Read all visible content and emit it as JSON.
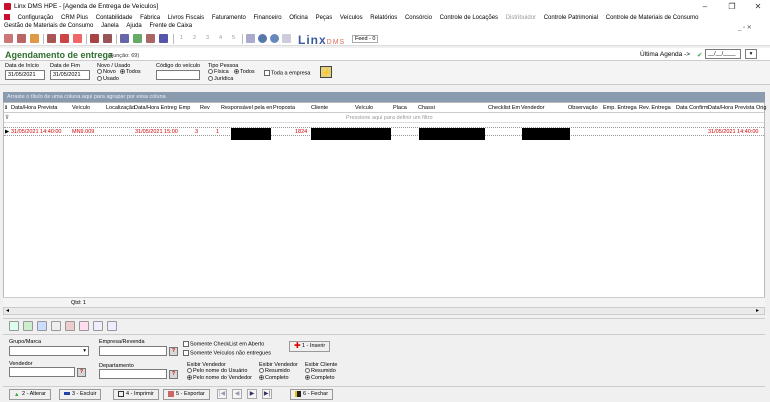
{
  "window": {
    "title": "Linx DMS HPE - [Agenda de Entrega de Veículos]",
    "minimize": "–",
    "restore": "❐",
    "close": "✕",
    "mdi_controls": "_ ▫ ✕"
  },
  "menu": {
    "row1": [
      "Configuração",
      "CRM Plus",
      "Contabilidade",
      "Fábrica",
      "Livros Fiscais",
      "Faturamento",
      "Financeiro",
      "Oficina",
      "Peças",
      "Veículos",
      "Relatórios",
      "Consórcio",
      "Controle de Locações",
      "Distribuidor",
      "Controle Patrimonial",
      "Controle de Materiais de Consumo"
    ],
    "row2": [
      "Gestão de Materiais de Consumo",
      "Janela",
      "Ajuda",
      "Frente de Caixa"
    ]
  },
  "toolbar": {
    "numbers": [
      "1",
      "2",
      "3",
      "4",
      "5"
    ],
    "brand": "Linx",
    "brand_suffix": "DMS",
    "feed": "Feed - 0"
  },
  "header": {
    "title": "Agendamento de entrega",
    "function": "(Função: 69)",
    "ultima_agenda": "Última Agenda ->",
    "ultima_agenda_value": "__/__/____"
  },
  "filters": {
    "data_inicio_label": "Data de Início",
    "data_inicio": "31/05/2021",
    "data_fim_label": "Data de Fim",
    "data_fim": "31/05/2021",
    "novo_usado_label": "Novo / Usado",
    "novo": "Novo",
    "todos": "Todos",
    "usado": "Usado",
    "codigo_veiculo_label": "Código do veículo",
    "codigo_veiculo": "",
    "tipo_pessoa_label": "Tipo Pessoa",
    "fisica": "Física",
    "todos2": "Todos",
    "juridica": "Jurídica",
    "toda_empresa": "Toda a empresa"
  },
  "grid": {
    "group_hint": "Arraste o título de uma coluna aqui para agrupar por essa coluna",
    "filter_row": "Pressione aqui para definir um filtro",
    "columns": [
      "Data/Hora Prevista",
      "Veículo",
      "Localização",
      "Data/Hora Entreg",
      "Emp",
      "Rev",
      "Responsável pela en",
      "Proposta",
      "Cliente",
      "Veículo",
      "Placa",
      "Chassi",
      "Checklist Em",
      "Vendedor",
      "Observação",
      "Emp. Entrega",
      "Rev. Entrega",
      "Data Confirm",
      "Data/Hora Prevista Orig"
    ],
    "row": {
      "data_hora_prevista": "31/05/2021 14:40:00",
      "veiculo": "MN9.009",
      "data_hora_entrega": "31/05/2021 15:00",
      "emp": "3",
      "rev": "1",
      "proposta": "1824",
      "data_hora_prevista_orig": "31/05/2021 14:40:00"
    },
    "qtd_label": "Qtd: 1"
  },
  "bottom": {
    "grupo_marca_label": "Grupo/Marca",
    "empresa_revenda_label": "Empresa/Revenda",
    "somente_checklist": "Somente CheckList em Aberto",
    "somente_veiculos": "Somente Veículos não entregues",
    "vendedor_label": "Vendedor",
    "departamento_label": "Departamento",
    "exibir_vendedor_label": "Exibir Vendedor",
    "pelo_nome_usuario": "Pelo nome do Usuário",
    "pelo_nome_vendedor": "Pelo nome do Vendedor",
    "exibir_vendedor2_label": "Exibir Vendedor",
    "resumido": "Resumido",
    "completo": "Completo",
    "exibir_cliente_label": "Exibir Cliente",
    "resumido2": "Resumido",
    "completo2": "Completo",
    "inserir": "1 - Inserir",
    "lookup": "?"
  },
  "buttons": {
    "alterar": "2 - Alterar",
    "excluir": "3 - Excluir",
    "imprimir": "4 - Imprimir",
    "exportar": "5 - Exportar",
    "fechar": "6 - Fechar",
    "nav": [
      "|◀",
      "◀",
      "▶",
      "▶|"
    ]
  },
  "colors": {
    "title_green": "#2f6f2f",
    "row_red": "#d00000",
    "group_band": "#8a9bb0"
  }
}
